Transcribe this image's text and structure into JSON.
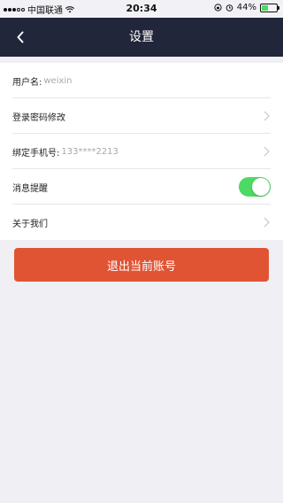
{
  "status_bar": {
    "carrier": "中国联通",
    "time": "20:34",
    "battery_percent": "44%",
    "battery_level": 0.44,
    "battery_color": "#4cd964"
  },
  "nav": {
    "title": "设置",
    "back_icon": "chevron-left-icon",
    "background_color": "#22263a"
  },
  "settings": {
    "username_label": "用户名:",
    "username_value": "weixin",
    "change_password_label": "登录密码修改",
    "bind_phone_label": "绑定手机号:",
    "bind_phone_value": "133****2213",
    "notification_label": "消息提醒",
    "notification_on": true,
    "about_label": "关于我们"
  },
  "logout": {
    "label": "退出当前账号",
    "color": "#e05434"
  }
}
